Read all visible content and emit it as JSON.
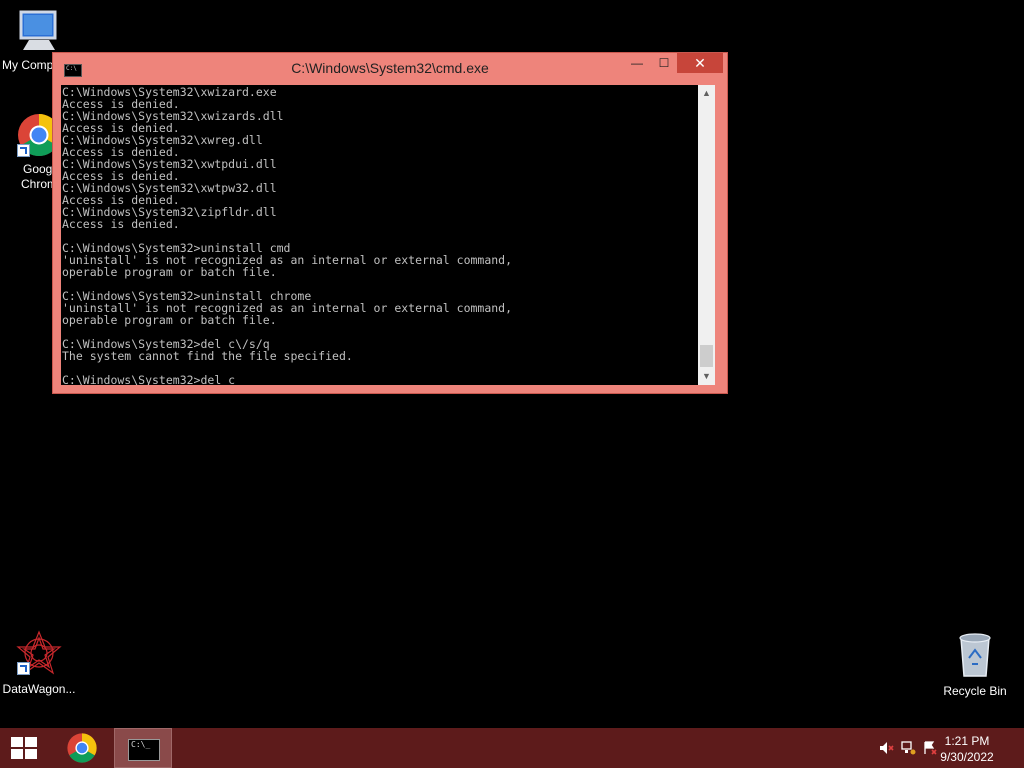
{
  "desktop": {
    "icons": [
      {
        "label": "My Comp"
      },
      {
        "label": "Googl\nChrom"
      },
      {
        "label": "DataWagon..."
      },
      {
        "label": "Recycle Bin"
      }
    ]
  },
  "window": {
    "title": "C:\\Windows\\System32\\cmd.exe",
    "icon_text": "C:\\",
    "minimize": "—",
    "maximize": "☐",
    "close": "✕",
    "console_lines": [
      "C:\\Windows\\System32\\xwizard.exe",
      "Access is denied.",
      "C:\\Windows\\System32\\xwizards.dll",
      "Access is denied.",
      "C:\\Windows\\System32\\xwreg.dll",
      "Access is denied.",
      "C:\\Windows\\System32\\xwtpdui.dll",
      "Access is denied.",
      "C:\\Windows\\System32\\xwtpw32.dll",
      "Access is denied.",
      "C:\\Windows\\System32\\zipfldr.dll",
      "Access is denied.",
      "",
      "C:\\Windows\\System32>uninstall cmd",
      "'uninstall' is not recognized as an internal or external command,",
      "operable program or batch file.",
      "",
      "C:\\Windows\\System32>uninstall chrome",
      "'uninstall' is not recognized as an internal or external command,",
      "operable program or batch file.",
      "",
      "C:\\Windows\\System32>del c\\/s/q",
      "The system cannot find the file specified.",
      "",
      "C:\\Windows\\System32>del c"
    ]
  },
  "taskbar": {
    "cmd_icon_text": "C:\\_",
    "time": "1:21 PM",
    "date": "9/30/2022"
  },
  "colors": {
    "desktop_bg": "#000000",
    "window_frame": "#ee847b",
    "taskbar_bg": "#5d1b1b",
    "console_text": "#c0c0c0"
  }
}
